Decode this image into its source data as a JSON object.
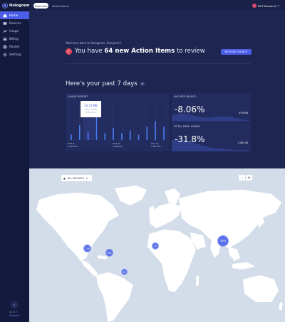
{
  "app": {
    "name": "Hologram"
  },
  "sidebar": {
    "items": [
      {
        "label": "Home",
        "icon": "home-icon"
      },
      {
        "label": "Devices",
        "icon": "devices-icon"
      },
      {
        "label": "Usage",
        "icon": "usage-icon"
      },
      {
        "label": "Billing",
        "icon": "billing-icon"
      },
      {
        "label": "Routes",
        "icon": "routes-icon"
      },
      {
        "label": "Settings",
        "icon": "gear-icon"
      }
    ],
    "active_index": 0,
    "version": "v3.0.7",
    "support": "Support"
  },
  "topbar": {
    "tabs": [
      "Overview",
      "Action Items"
    ],
    "active_tab": "Overview",
    "org": "NCS Research"
  },
  "welcome": {
    "greeting": "Welcome back to Hologram, Benjamin!",
    "prefix": "You have ",
    "count_text": "64 new Action Items",
    "suffix": " to review",
    "review_button": "REVIEW EVENTS"
  },
  "period": {
    "label": "Here's your past 7 days"
  },
  "usage_report": {
    "title": "USAGE REPORT",
    "tooltip_value": "14.23 MB",
    "tooltip_date": "OCT 5 2018",
    "tooltip_time": "3 PM UTC",
    "x_labels": [
      {
        "date": "OCT 9",
        "time": "4 AM UTC"
      },
      {
        "date": "OCT 10",
        "time": "4 AM UTC"
      },
      {
        "date": "OCT 11",
        "time": "4 PM UTC"
      }
    ],
    "bar_levels": [
      0.2,
      0.55,
      0.3,
      0.85,
      0.25,
      0.45,
      0.25,
      0.35,
      0.2,
      0.5,
      0.7,
      0.5
    ]
  },
  "metrics": {
    "avg": {
      "label": "AVG PER DEVICE",
      "value": "-8.06%",
      "sub": "593 KB"
    },
    "total": {
      "label": "TOTAL DATA USAGE",
      "value": "-31.8%",
      "sub": "2.48 GB"
    }
  },
  "map": {
    "filter": "ALL DEVICES",
    "zoom_out": "−",
    "zoom_in": "+",
    "markers": [
      "128",
      "264",
      "22",
      "2634",
      "63"
    ]
  },
  "colors": {
    "accent": "#4b5ee8",
    "alert": "#e5495d",
    "sidebar": "#141a3d",
    "background": "#1d2551"
  }
}
